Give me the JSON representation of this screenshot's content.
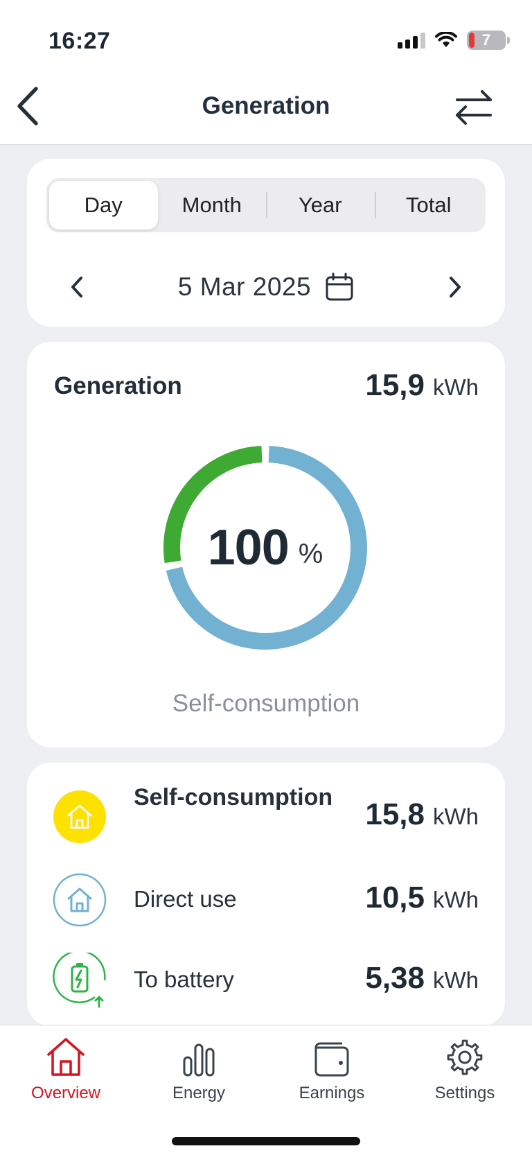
{
  "status_bar": {
    "time": "16:27",
    "battery_level": "7"
  },
  "header": {
    "title": "Generation",
    "back_icon": "chevron-left-icon",
    "swap_icon": "swap-arrows-icon"
  },
  "period_tabs": [
    {
      "label": "Day",
      "active": true
    },
    {
      "label": "Month",
      "active": false
    },
    {
      "label": "Year",
      "active": false
    },
    {
      "label": "Total",
      "active": false
    }
  ],
  "date": {
    "label": "5 Mar 2025",
    "icon": "calendar-icon"
  },
  "generation": {
    "title": "Generation",
    "value": "15,9",
    "unit": "kWh",
    "self_consumption_percent": "100",
    "percent_unit": "%",
    "caption": "Self-consumption",
    "ring_share_green": 0.28,
    "ring_share_blue": 0.72
  },
  "breakdown": [
    {
      "label": "Self-consumption",
      "value": "15,8",
      "unit": "kWh",
      "icon": "home-filled-icon"
    },
    {
      "label": "Direct use",
      "value": "10,5",
      "unit": "kWh",
      "icon": "home-outline-icon"
    },
    {
      "label": "To battery",
      "value": "5,38",
      "unit": "kWh",
      "icon": "battery-charge-icon"
    }
  ],
  "tabbar": [
    {
      "label": "Overview",
      "icon": "home-icon",
      "active": true
    },
    {
      "label": "Energy",
      "icon": "bar-chart-icon",
      "active": false
    },
    {
      "label": "Earnings",
      "icon": "wallet-icon",
      "active": false
    },
    {
      "label": "Settings",
      "icon": "gear-icon",
      "active": false
    }
  ],
  "colors": {
    "accent_red": "#d8121f",
    "ring_green": "#3eaa33",
    "ring_blue": "#72b1d2",
    "yellow": "#fde100",
    "battery_green": "#2db34a"
  }
}
